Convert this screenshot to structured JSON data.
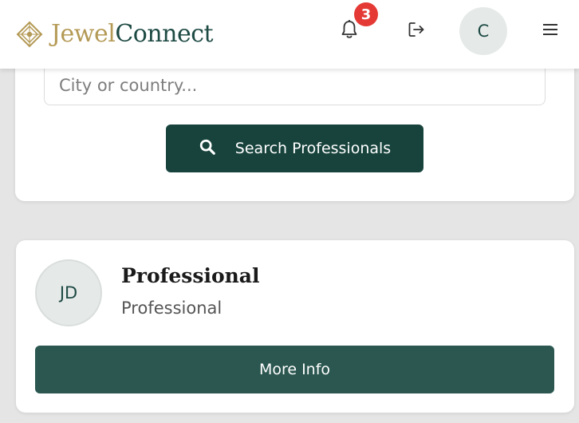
{
  "header": {
    "logo_jewel": "Jewel",
    "logo_connect": "Connect",
    "notification_count": "3",
    "user_initial": "C"
  },
  "search": {
    "location_placeholder": "City or country...",
    "submit_label": "Search Professionals"
  },
  "results": [
    {
      "initials": "JD",
      "name": "Professional",
      "role": "Professional",
      "more_info_label": "More Info"
    }
  ],
  "colors": {
    "brand_gold": "#b49a56",
    "brand_green": "#1e4a44",
    "primary_button": "#17433c",
    "secondary_button": "#2b5750",
    "badge": "#e53935"
  },
  "icons": {
    "logo": "diamond-logo-icon",
    "notifications": "bell-icon",
    "logout": "logout-icon",
    "menu": "hamburger-menu-icon",
    "search": "search-icon"
  }
}
